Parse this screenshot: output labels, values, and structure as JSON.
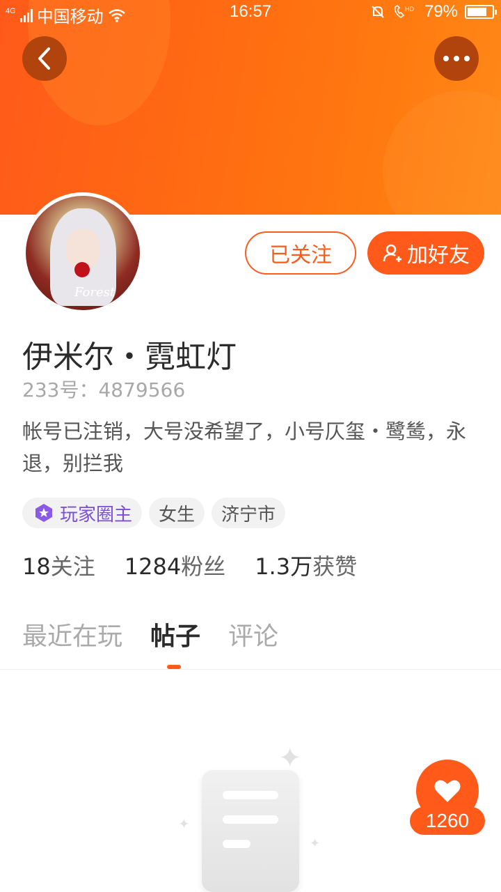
{
  "status_bar": {
    "network_type": "4G",
    "carrier": "中国移动",
    "time": "16:57",
    "battery_percent": "79%",
    "battery_level": 0.79,
    "icons": [
      "signal-icon",
      "wifi-icon",
      "mute-bell-icon",
      "hd-call-icon",
      "battery-icon"
    ]
  },
  "header": {
    "back_icon": "chevron-left-icon",
    "more_icon": "more-dots-icon",
    "accent_color": "#ff5a1a"
  },
  "profile": {
    "avatar_signature": "Forest",
    "name": "伊米尔・霓虹灯",
    "id_label": "233号：",
    "id_value": "4879566",
    "bio": "帐号已注销，大号没希望了，小号仄玺・鹭鸶，永退，别拦我",
    "followed_button": "已关注",
    "add_friend_button": "加好友",
    "tags": {
      "host": "玩家圈主",
      "gender": "女生",
      "city": "济宁市"
    },
    "stats": {
      "following_count": "18",
      "following_label": "关注",
      "fans_count": "1284",
      "fans_label": "粉丝",
      "likes_count": "1.3万",
      "likes_label": "获赞"
    }
  },
  "tabs": {
    "recent": "最近在玩",
    "posts": "帖子",
    "comments": "评论",
    "active": "帖子"
  },
  "like_button": {
    "count": "1260",
    "icon": "heart-icon"
  }
}
